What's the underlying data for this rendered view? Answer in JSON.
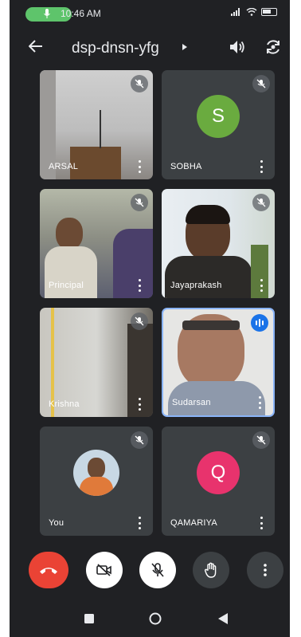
{
  "status_bar": {
    "time": "10:46 AM"
  },
  "header": {
    "title": "dsp-dnsn-yfg"
  },
  "participants": [
    {
      "name": "ARSAL"
    },
    {
      "name": "SOBHA",
      "initial": "S",
      "avatar_color": "#6aab3f"
    },
    {
      "name": "Principal"
    },
    {
      "name": "Jayaprakash"
    },
    {
      "name": "Krishna"
    },
    {
      "name": "Sudarsan"
    },
    {
      "name": "You"
    },
    {
      "name": "QAMARIYA",
      "initial": "Q",
      "avatar_color": "#e8336d"
    }
  ],
  "icons": [
    "mic-icon",
    "back-arrow-icon",
    "speaker-icon",
    "switch-camera-icon",
    "mic-off-icon",
    "more-vert-icon",
    "audio-wave-icon",
    "end-call-icon",
    "camera-off-icon",
    "raise-hand-icon",
    "stop-icon",
    "home-icon",
    "back-triangle-icon"
  ],
  "colors": {
    "background": "#202124",
    "tile": "#3c4043",
    "end_call": "#ea4335",
    "active_speaker": "#1a73e8",
    "mic_indicator": "#5ec46b"
  }
}
